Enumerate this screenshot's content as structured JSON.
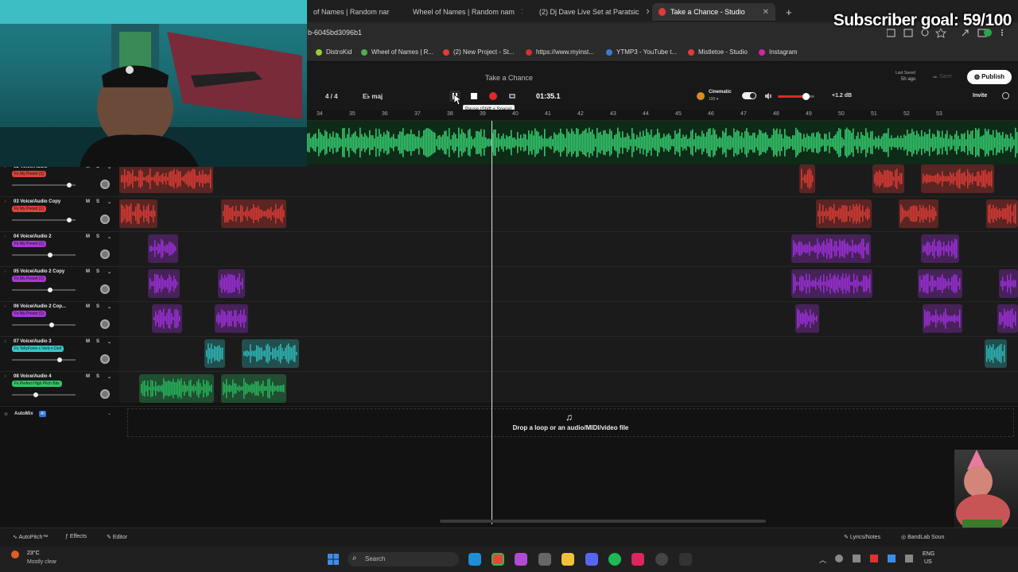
{
  "browser": {
    "tabs": [
      {
        "label": "of Names | Random nar",
        "active": false
      },
      {
        "label": "Wheel of Names | Random nam",
        "active": false
      },
      {
        "label": "(2) Dj Dave Live Set at Paratsic",
        "active": false
      },
      {
        "label": "Take a Chance - Studio",
        "active": true
      }
    ],
    "new_tab": "+",
    "url": "b-6045bd3096b1",
    "bookmarks": [
      "DistroKid",
      "Wheel of Names | R...",
      "(2) New Project - St...",
      "https://www.myinst...",
      "YTMP3 - YouTube t...",
      "Mistletoe - Studio",
      "Instagram"
    ]
  },
  "stream": {
    "subscriber_goal": "Subscriber goal: 59/100"
  },
  "studio": {
    "song_title": "Take a Chance",
    "time_signature": "4 / 4",
    "key": "E♭ maj",
    "time_display": "01:35.1",
    "tooltip": "Pause (Shift + Space)",
    "mastering": {
      "label": "Cinematic",
      "value": "100 ▾"
    },
    "volume_db": "+1.2 dB",
    "last_saved_label": "Last Saved",
    "last_saved_value": "5h ago",
    "save_label": "Save",
    "publish_label": "Publish",
    "invite_label": "Invite",
    "ruler": [
      "34",
      "35",
      "36",
      "37",
      "38",
      "39",
      "40",
      "41",
      "42",
      "43",
      "44",
      "45",
      "46",
      "47",
      "48",
      "49",
      "50",
      "51",
      "52",
      "53"
    ],
    "playhead_bar": 39.3,
    "tracks": [
      {
        "name": "02 Voice/Audio",
        "fx": "Fx My Preset (1)",
        "fx_color": "#e0403a",
        "color": "#d83a34",
        "volume": 0.9
      },
      {
        "name": "03 Voice/Audio Copy",
        "fx": "Fx My Preset (1)",
        "fx_color": "#e0403a",
        "color": "#d83a34",
        "volume": 0.9
      },
      {
        "name": "04 Voice/Audio 2",
        "fx": "Fx My Preset (1)",
        "fx_color": "#a838d8",
        "color": "#9b2fd6",
        "volume": 0.6
      },
      {
        "name": "05 Voice/Audio 2 Copy",
        "fx": "Fx My Preset (1)",
        "fx_color": "#a838d8",
        "color": "#9b2fd6",
        "volume": 0.6
      },
      {
        "name": "06 Voice/Audio 2 Cop...",
        "fx": "Fx My Preset (1)",
        "fx_color": "#a838d8",
        "color": "#9b2fd6",
        "volume": 0.62
      },
      {
        "name": "07 Voice/Audio 3",
        "fx": "Fx TellyFonix x Verb n Delf",
        "fx_color": "#37c7c7",
        "color": "#2fb5b5",
        "volume": 0.75
      },
      {
        "name": "08 Voice/Audio 4",
        "fx": "Fx Perfect High Pitch Bits",
        "fx_color": "#2ec76a",
        "color": "#27b35b",
        "volume": 0.37
      }
    ],
    "mute_label": "M",
    "solo_label": "S",
    "automix_label": "AutoMix",
    "automix_badge": "AI",
    "drop_text": "Drop a loop or an audio/MIDI/video file",
    "bottom": {
      "autopitch": "AutoPitch™",
      "effects": "Effects",
      "editor": "Editor",
      "lyrics": "Lyrics/Notes",
      "bandlab_sounds": "BandLab Soun"
    }
  },
  "taskbar": {
    "weather_temp": "23°C",
    "weather_desc": "Mostly clear",
    "search_placeholder": "Search",
    "lang_top": "ENG",
    "lang_bottom": "US"
  },
  "colors": {
    "red": "#d83a34",
    "purple": "#9b2fd6",
    "teal": "#2fb5b5",
    "green": "#27b35b",
    "accent": "#00c48c"
  }
}
